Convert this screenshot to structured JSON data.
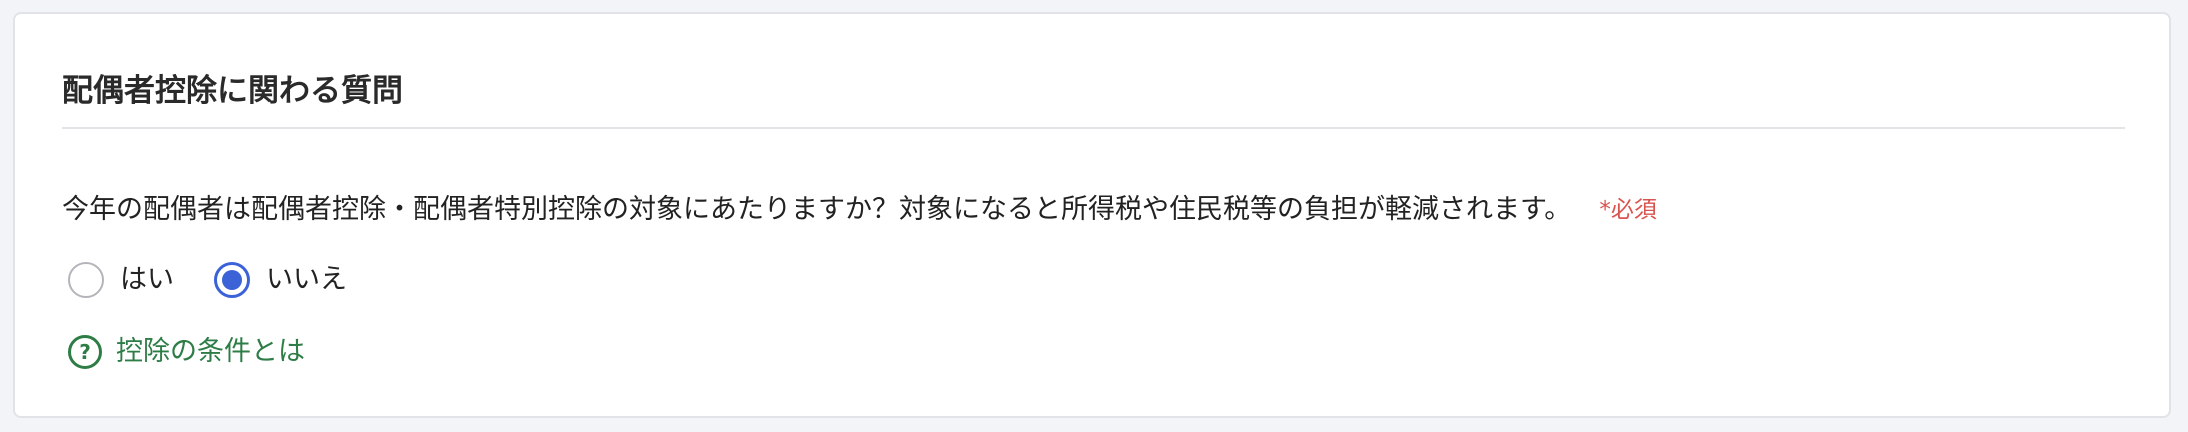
{
  "section": {
    "title": "配偶者控除に関わる質問"
  },
  "question": {
    "text": "今年の配偶者は配偶者控除・配偶者特別控除の対象にあたりますか？対象になると所得税や住民税等の負担が軽減されます。",
    "required_label": "*必須",
    "options": [
      {
        "label": "はい",
        "selected": false
      },
      {
        "label": "いいえ",
        "selected": true
      }
    ]
  },
  "help": {
    "icon_glyph": "?",
    "icon_name": "question-circle-icon",
    "link_text": "控除の条件とは"
  },
  "colors": {
    "accent": "#3b63d7",
    "link": "#2e7d46",
    "required": "#d9534f"
  }
}
